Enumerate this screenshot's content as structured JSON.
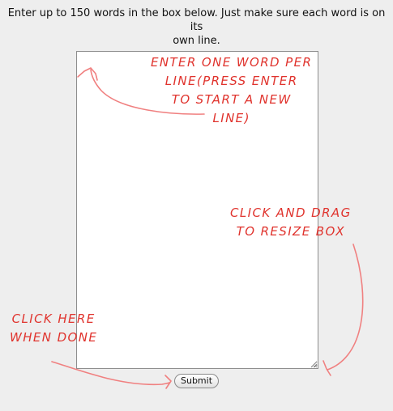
{
  "instructions": {
    "line1": "Enter up to 150 words in the box below. Just make sure each word is on its",
    "line2": "own line."
  },
  "words_box": {
    "value": ""
  },
  "submit": {
    "label": "Submit"
  },
  "annotations": {
    "color": "#e0332d",
    "enter_word": [
      "ENTER ONE WORD PER",
      "LINE(PRESS ENTER",
      "TO START A NEW",
      "LINE)"
    ],
    "resize": [
      "CLICK AND DRAG",
      "TO RESIZE BOX"
    ],
    "click_here": [
      "CLICK HERE",
      "WHEN DONE"
    ]
  }
}
